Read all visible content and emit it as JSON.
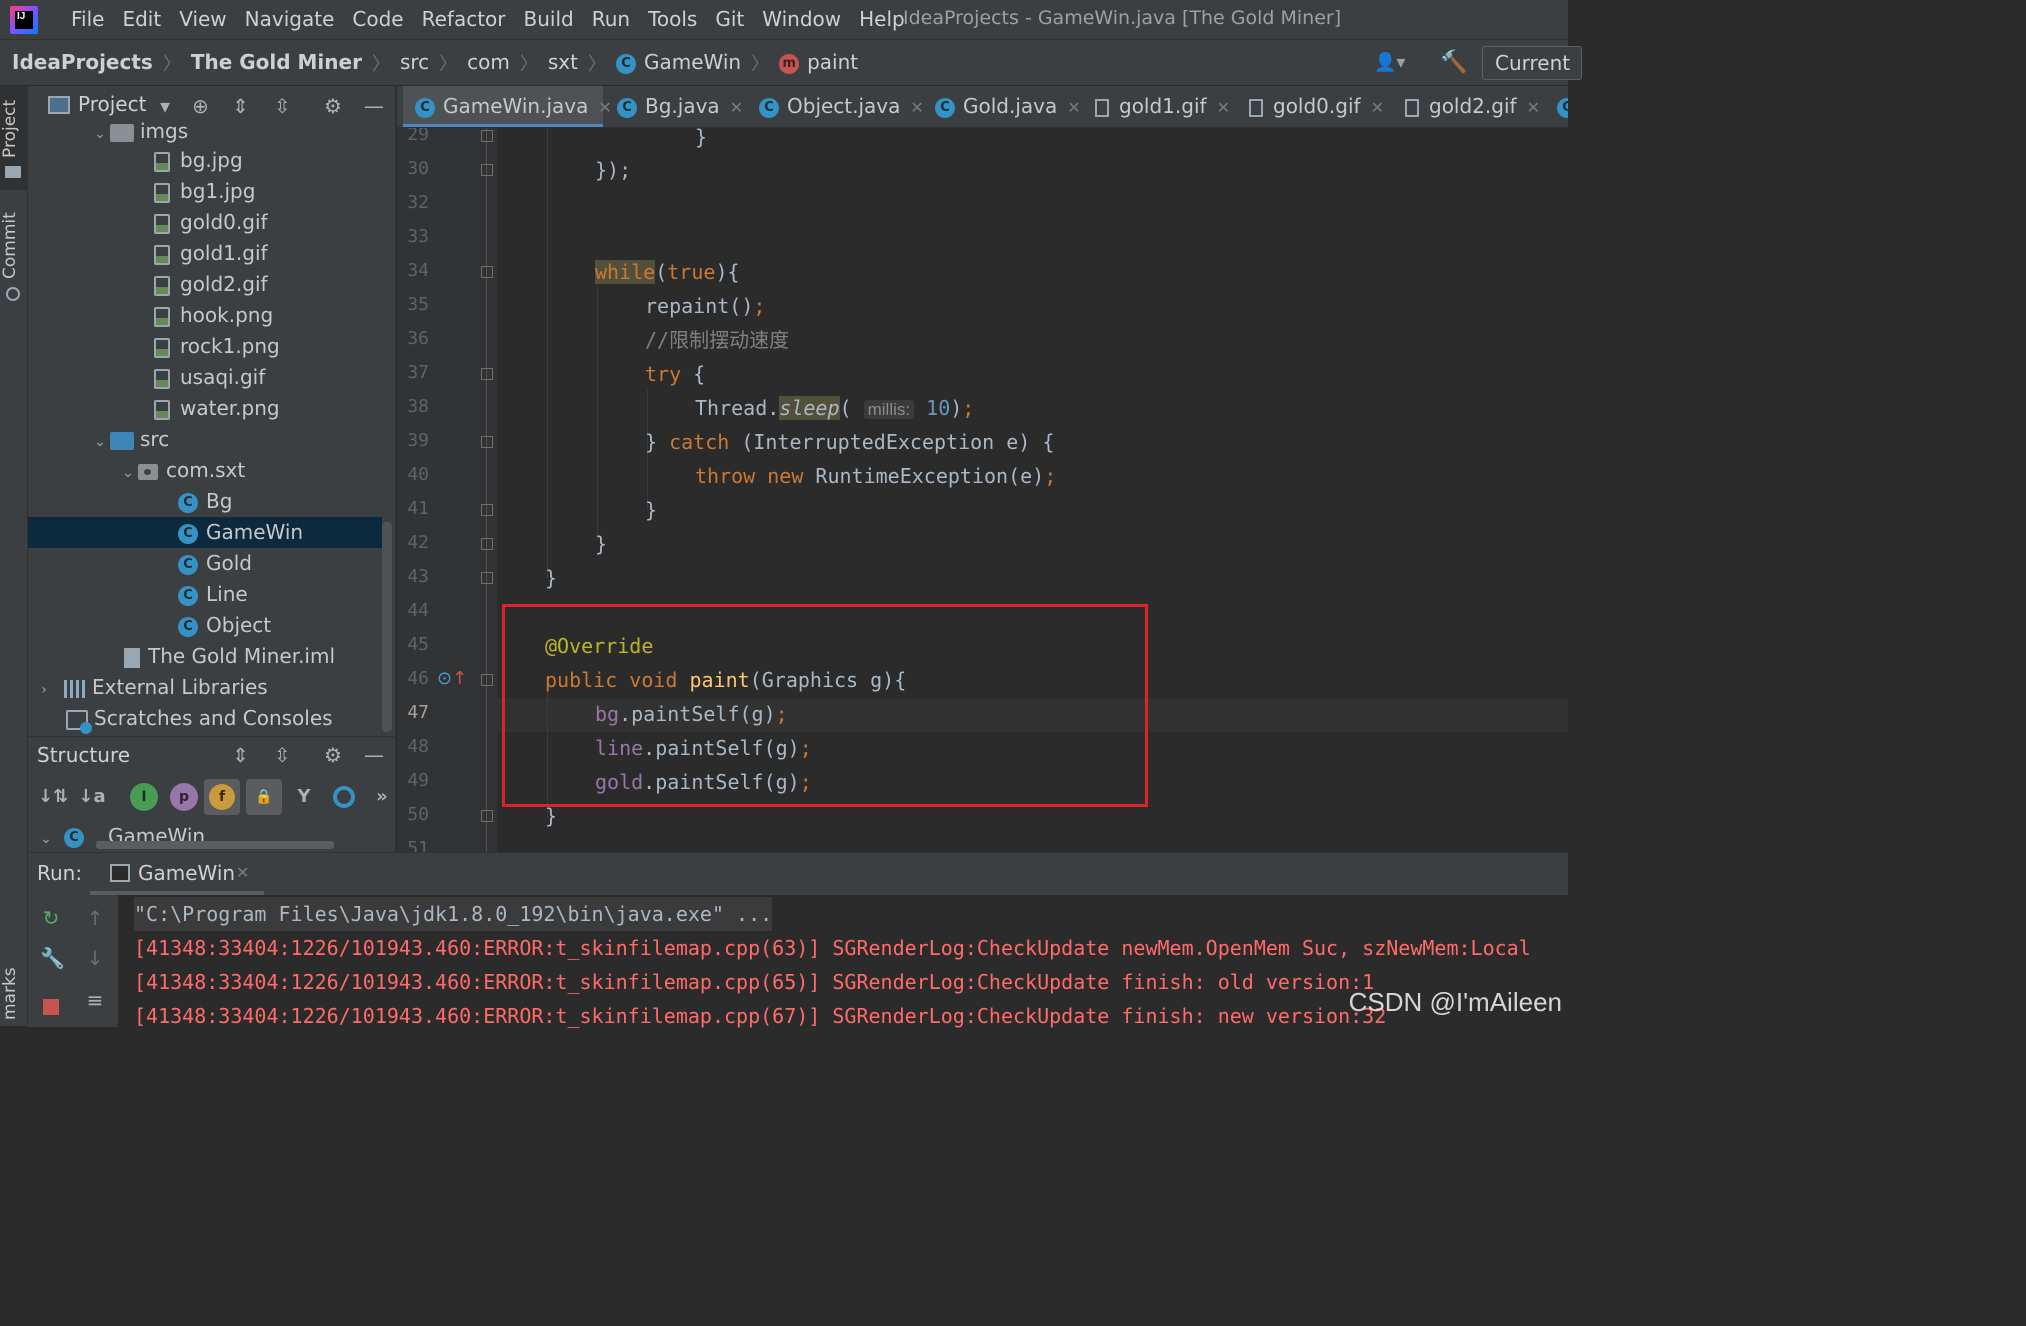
{
  "menu": {
    "items": [
      "File",
      "Edit",
      "View",
      "Navigate",
      "Code",
      "Refactor",
      "Build",
      "Run",
      "Tools",
      "Git",
      "Window",
      "Help"
    ],
    "title": "IdeaProjects - GameWin.java [The Gold Miner]"
  },
  "breadcrumb": {
    "items": [
      "IdeaProjects",
      "The Gold Miner",
      "src",
      "com",
      "sxt",
      "GameWin",
      "paint"
    ],
    "run_config": "Current"
  },
  "left_stripe": {
    "project_tab": "Project",
    "commit_tab": "Commit",
    "bookmarks_tab": "marks"
  },
  "project": {
    "title": "Project",
    "tree": [
      {
        "label": "imgs"
      },
      {
        "label": "bg.jpg"
      },
      {
        "label": "bg1.jpg"
      },
      {
        "label": "gold0.gif"
      },
      {
        "label": "gold1.gif"
      },
      {
        "label": "gold2.gif"
      },
      {
        "label": "hook.png"
      },
      {
        "label": "rock1.png"
      },
      {
        "label": "usaqi.gif"
      },
      {
        "label": "water.png"
      },
      {
        "label": "src"
      },
      {
        "label": "com.sxt"
      },
      {
        "label": "Bg"
      },
      {
        "label": "GameWin"
      },
      {
        "label": "Gold"
      },
      {
        "label": "Line"
      },
      {
        "label": "Object"
      },
      {
        "label": "The Gold Miner.iml"
      },
      {
        "label": "External Libraries"
      },
      {
        "label": "Scratches and Consoles"
      }
    ]
  },
  "structure": {
    "title": "Structure",
    "root": "GameWin"
  },
  "tabs": [
    "GameWin.java",
    "Bg.java",
    "Object.java",
    "Gold.java",
    "gold1.gif",
    "gold0.gif",
    "gold2.gif"
  ],
  "editor": {
    "line_numbers": [
      "29",
      "30",
      "32",
      "33",
      "34",
      "35",
      "36",
      "37",
      "38",
      "39",
      "40",
      "41",
      "42",
      "43",
      "44",
      "45",
      "46",
      "47",
      "48",
      "49",
      "50",
      "51"
    ],
    "hint_label": "millis:",
    "comment": "//限制摆动速度"
  },
  "run": {
    "label": "Run:",
    "tab": "GameWin",
    "lines": [
      "\"C:\\Program Files\\Java\\jdk1.8.0_192\\bin\\java.exe\" ...",
      "[41348:33404:1226/101943.460:ERROR:t_skinfilemap.cpp(63)] SGRenderLog:CheckUpdate newMem.OpenMem Suc, szNewMem:Local",
      "[41348:33404:1226/101943.460:ERROR:t_skinfilemap.cpp(65)] SGRenderLog:CheckUpdate finish: old version:1",
      "[41348:33404:1226/101943.460:ERROR:t_skinfilemap.cpp(67)] SGRenderLog:CheckUpdate finish: new version:32"
    ]
  },
  "watermark": "CSDN @I'mAileen",
  "colors": {
    "accent": "#4a88c7",
    "highlight_box": "#e0202a",
    "error_text": "#ff6b68"
  }
}
